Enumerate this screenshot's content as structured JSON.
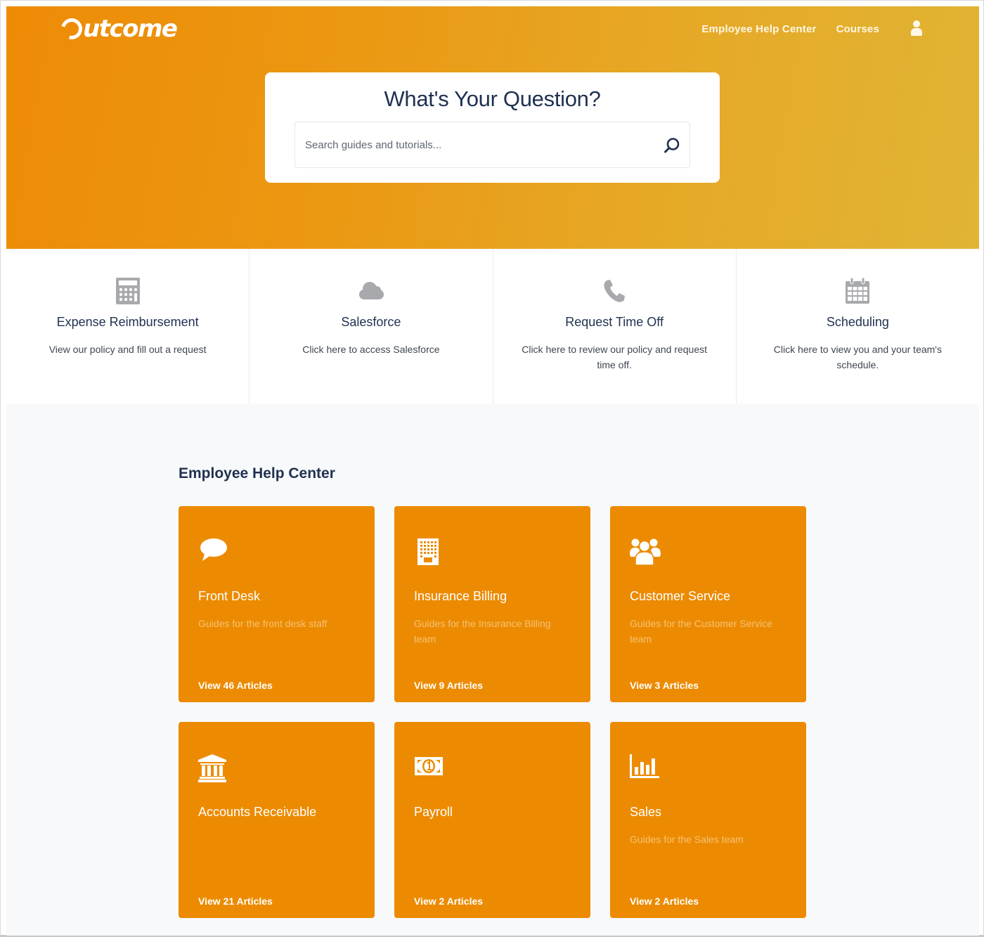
{
  "brand": {
    "logo_text": "utcome",
    "logo_full": "Outcome"
  },
  "nav": {
    "items": [
      {
        "label": "Employee Help Center"
      },
      {
        "label": "Courses"
      }
    ],
    "user_icon": "user-icon"
  },
  "search": {
    "title": "What's Your Question?",
    "placeholder": "Search guides and tutorials...",
    "value": "",
    "icon": "search-icon"
  },
  "quicklinks": [
    {
      "icon": "calculator-icon",
      "title": "Expense Reimbursement",
      "description": "View our policy and fill out a request"
    },
    {
      "icon": "cloud-icon",
      "title": "Salesforce",
      "description": "Click here to access Salesforce"
    },
    {
      "icon": "phone-icon",
      "title": "Request Time Off",
      "description": "Click here to review our policy and request time off."
    },
    {
      "icon": "calendar-icon",
      "title": "Scheduling",
      "description": "Click here to view you and your team's schedule."
    }
  ],
  "help_center": {
    "title": "Employee Help Center",
    "categories": [
      {
        "icon": "chat-bubble-icon",
        "name": "Front Desk",
        "description": "Guides for the front desk staff",
        "link": "View 46 Articles"
      },
      {
        "icon": "building-icon",
        "name": "Insurance Billing",
        "description": "Guides for the Insurance Billing team",
        "link": "View 9 Articles"
      },
      {
        "icon": "users-icon",
        "name": "Customer Service",
        "description": "Guides for the Customer Service team",
        "link": "View 3 Articles"
      },
      {
        "icon": "bank-icon",
        "name": "Accounts Receivable",
        "description": "",
        "link": "View 21 Articles"
      },
      {
        "icon": "money-icon",
        "name": "Payroll",
        "description": "",
        "link": "View 2 Articles"
      },
      {
        "icon": "bar-chart-icon",
        "name": "Sales",
        "description": "Guides for the Sales team",
        "link": "View 2 Articles"
      }
    ]
  },
  "colors": {
    "hero_start": "#ee8b06",
    "hero_end": "#e1b434",
    "tile": "#ec8b02",
    "heading": "#1f3150",
    "icon_gray": "#a7a9ad"
  }
}
